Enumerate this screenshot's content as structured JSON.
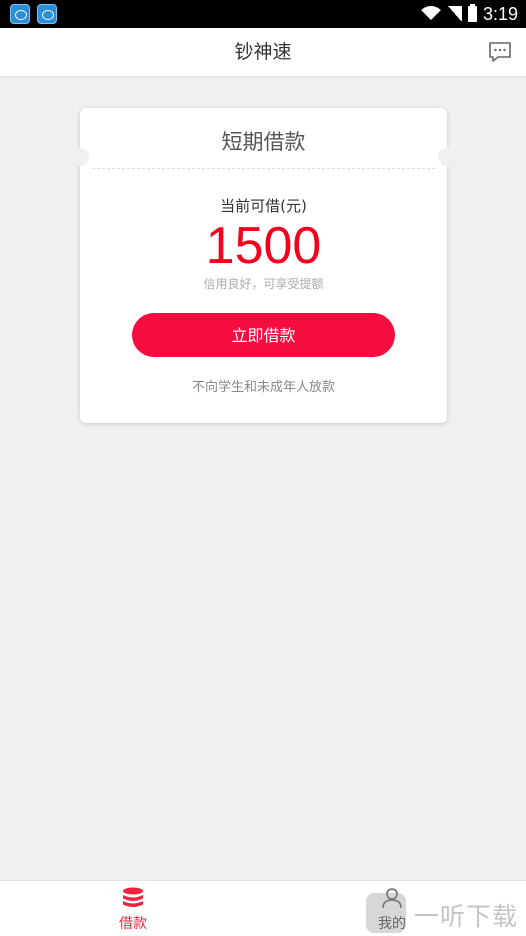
{
  "status_bar": {
    "time": "3:19"
  },
  "header": {
    "title": "钞神速"
  },
  "card": {
    "title": "短期借款",
    "available_label": "当前可借(元)",
    "amount": "1500",
    "credit_note": "信用良好，可享受提额",
    "cta_label": "立即借款",
    "disclaimer": "不向学生和未成年人放款"
  },
  "tabs": [
    {
      "label": "借款",
      "icon": "coins-stack-icon",
      "active": true
    },
    {
      "label": "我的",
      "icon": "user-icon",
      "active": false
    }
  ],
  "watermark": {
    "text": "一听下载"
  },
  "colors": {
    "accent": "#f50d3f",
    "amount": "#f2001d",
    "background": "#f0f0f0"
  }
}
